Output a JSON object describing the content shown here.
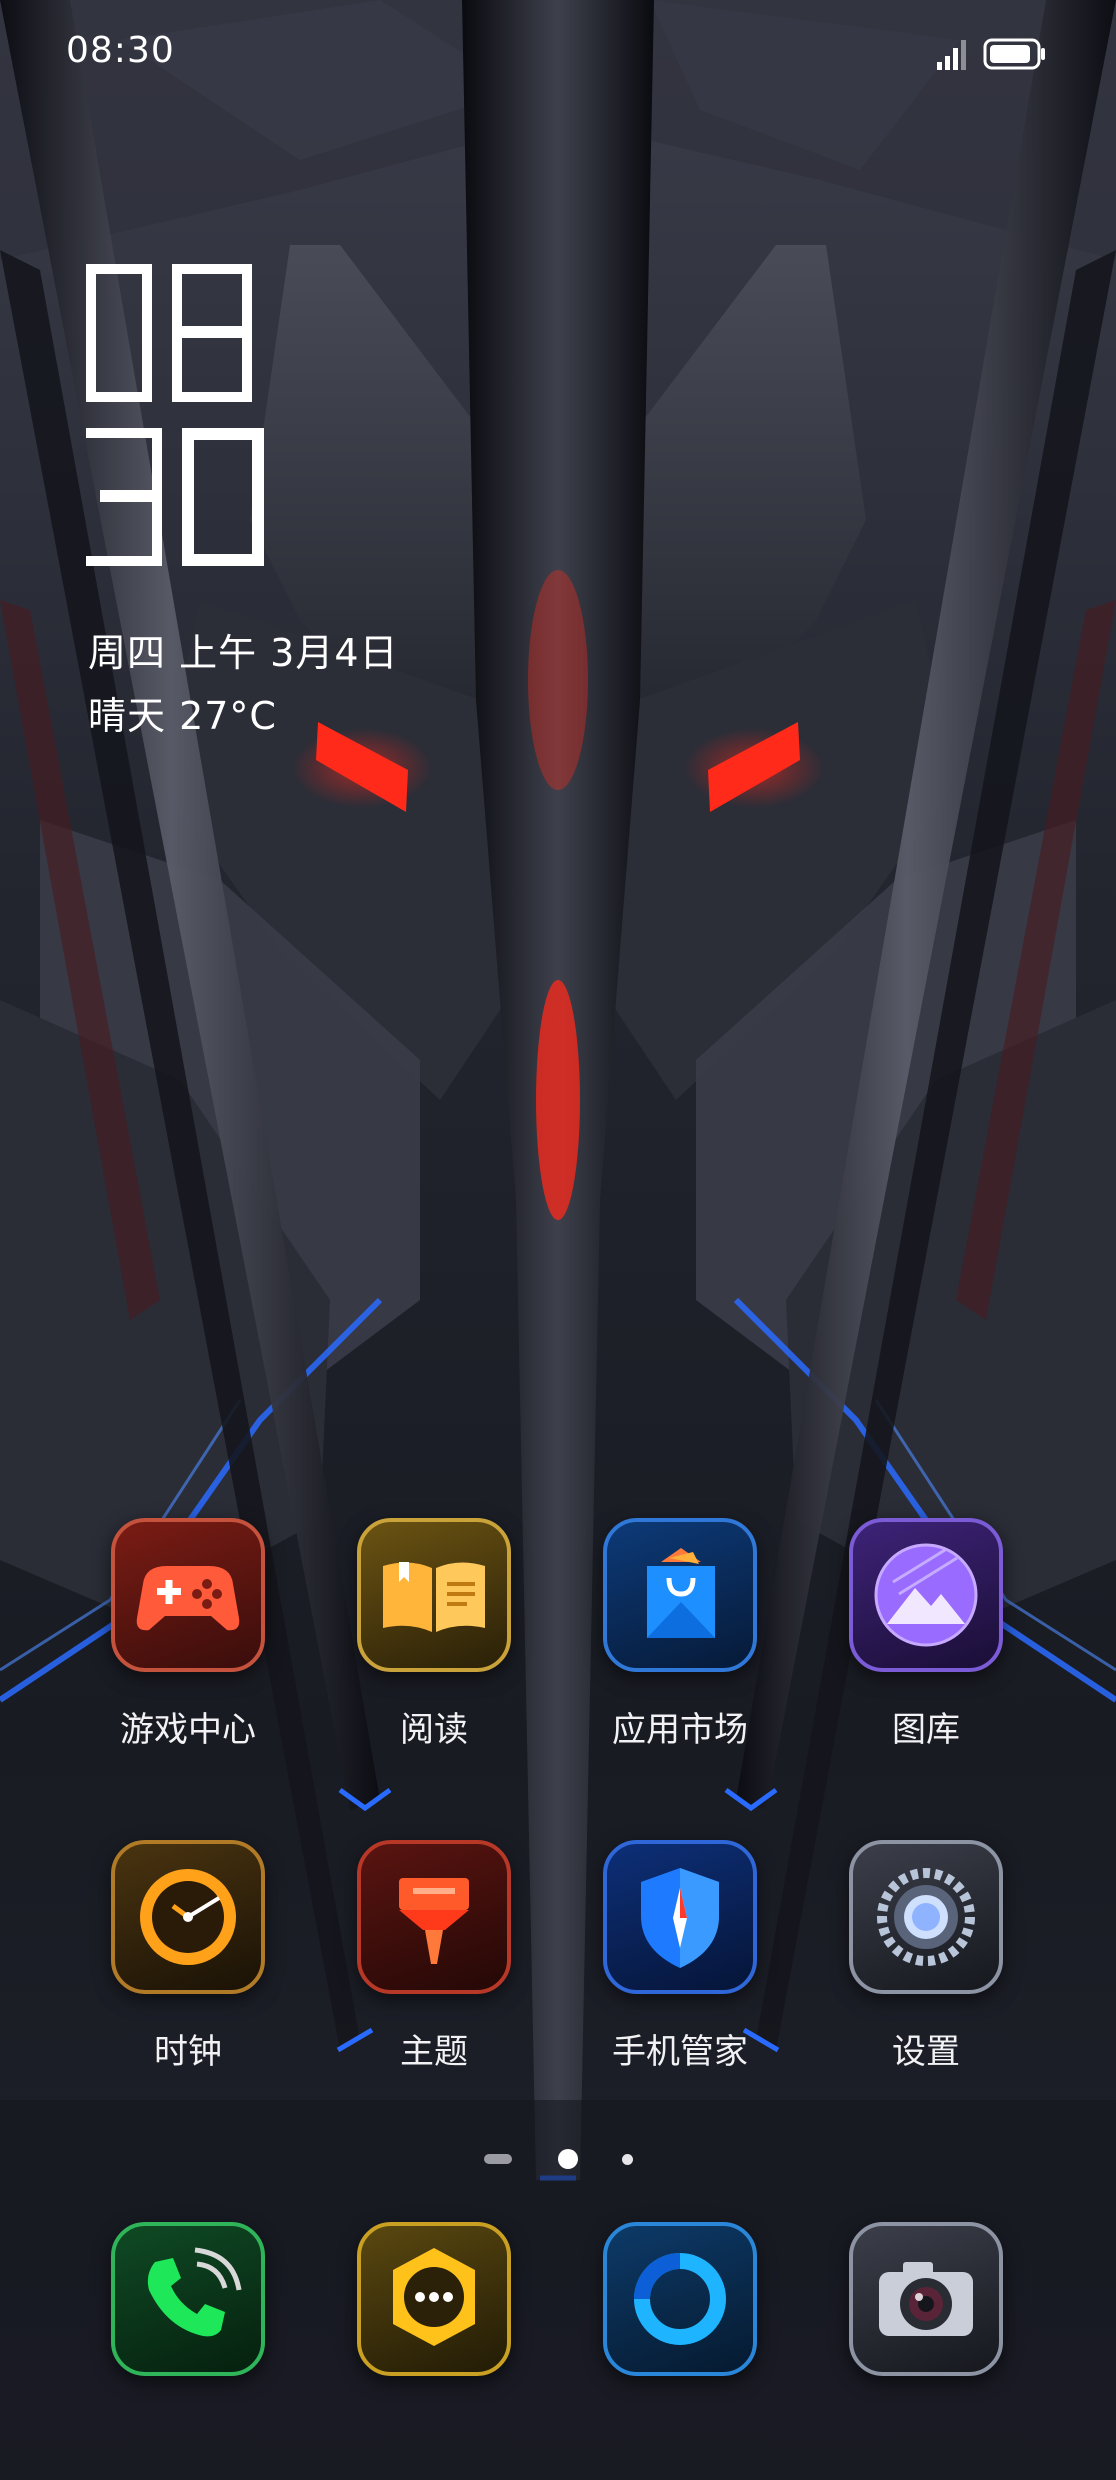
{
  "status_bar": {
    "time": "08:30",
    "signal_icon": "cellular-signal-icon",
    "battery_icon": "battery-icon"
  },
  "clock_widget": {
    "hours": "08",
    "minutes": "30",
    "date": "周四 上午  3月4日",
    "weather": "晴天 27°C"
  },
  "apps": [
    {
      "label": "游戏中心",
      "icon": "gamepad-icon"
    },
    {
      "label": "阅读",
      "icon": "open-book-icon"
    },
    {
      "label": "应用市场",
      "icon": "shopping-bag-icon"
    },
    {
      "label": "图库",
      "icon": "mountain-photo-icon"
    },
    {
      "label": "时钟",
      "icon": "clock-icon"
    },
    {
      "label": "主题",
      "icon": "theme-brush-icon"
    },
    {
      "label": "手机管家",
      "icon": "shield-compass-icon"
    },
    {
      "label": "设置",
      "icon": "gear-icon"
    }
  ],
  "dock": [
    {
      "icon": "phone-icon"
    },
    {
      "icon": "message-bubble-icon"
    },
    {
      "icon": "browser-ring-icon"
    },
    {
      "icon": "camera-icon"
    }
  ],
  "page_indicator": {
    "pages": 3,
    "current": 2
  },
  "colors": {
    "accent_red": "#ff2a1a",
    "accent_blue": "#2a6bff",
    "background": "#14161d"
  }
}
